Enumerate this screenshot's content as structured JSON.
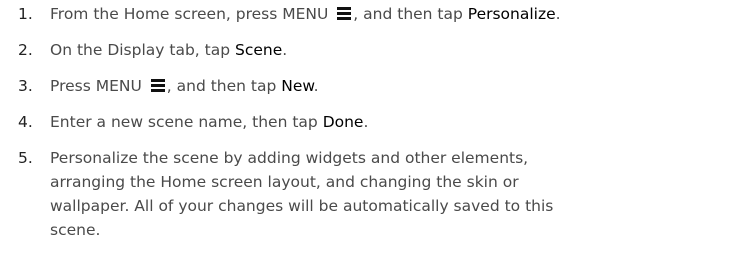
{
  "steps": [
    {
      "number": "1.",
      "parts": [
        "From the Home screen, press MENU ",
        ", and then tap ",
        "Personalize",
        "."
      ]
    },
    {
      "number": "2.",
      "parts": [
        "On the Display tab, tap ",
        "Scene",
        "."
      ]
    },
    {
      "number": "3.",
      "parts": [
        "Press MENU ",
        ", and then tap ",
        "New",
        "."
      ]
    },
    {
      "number": "4.",
      "parts": [
        "Enter a new scene name, then tap ",
        "Done",
        "."
      ]
    },
    {
      "number": "5.",
      "line1": "Personalize the scene by adding widgets and other elements,",
      "line2": "arranging the Home screen layout, and changing the skin or",
      "line3": "wallpaper. All of your changes will be automatically saved to this",
      "line4": "scene."
    }
  ],
  "icons": {
    "menu": "menu-icon"
  }
}
